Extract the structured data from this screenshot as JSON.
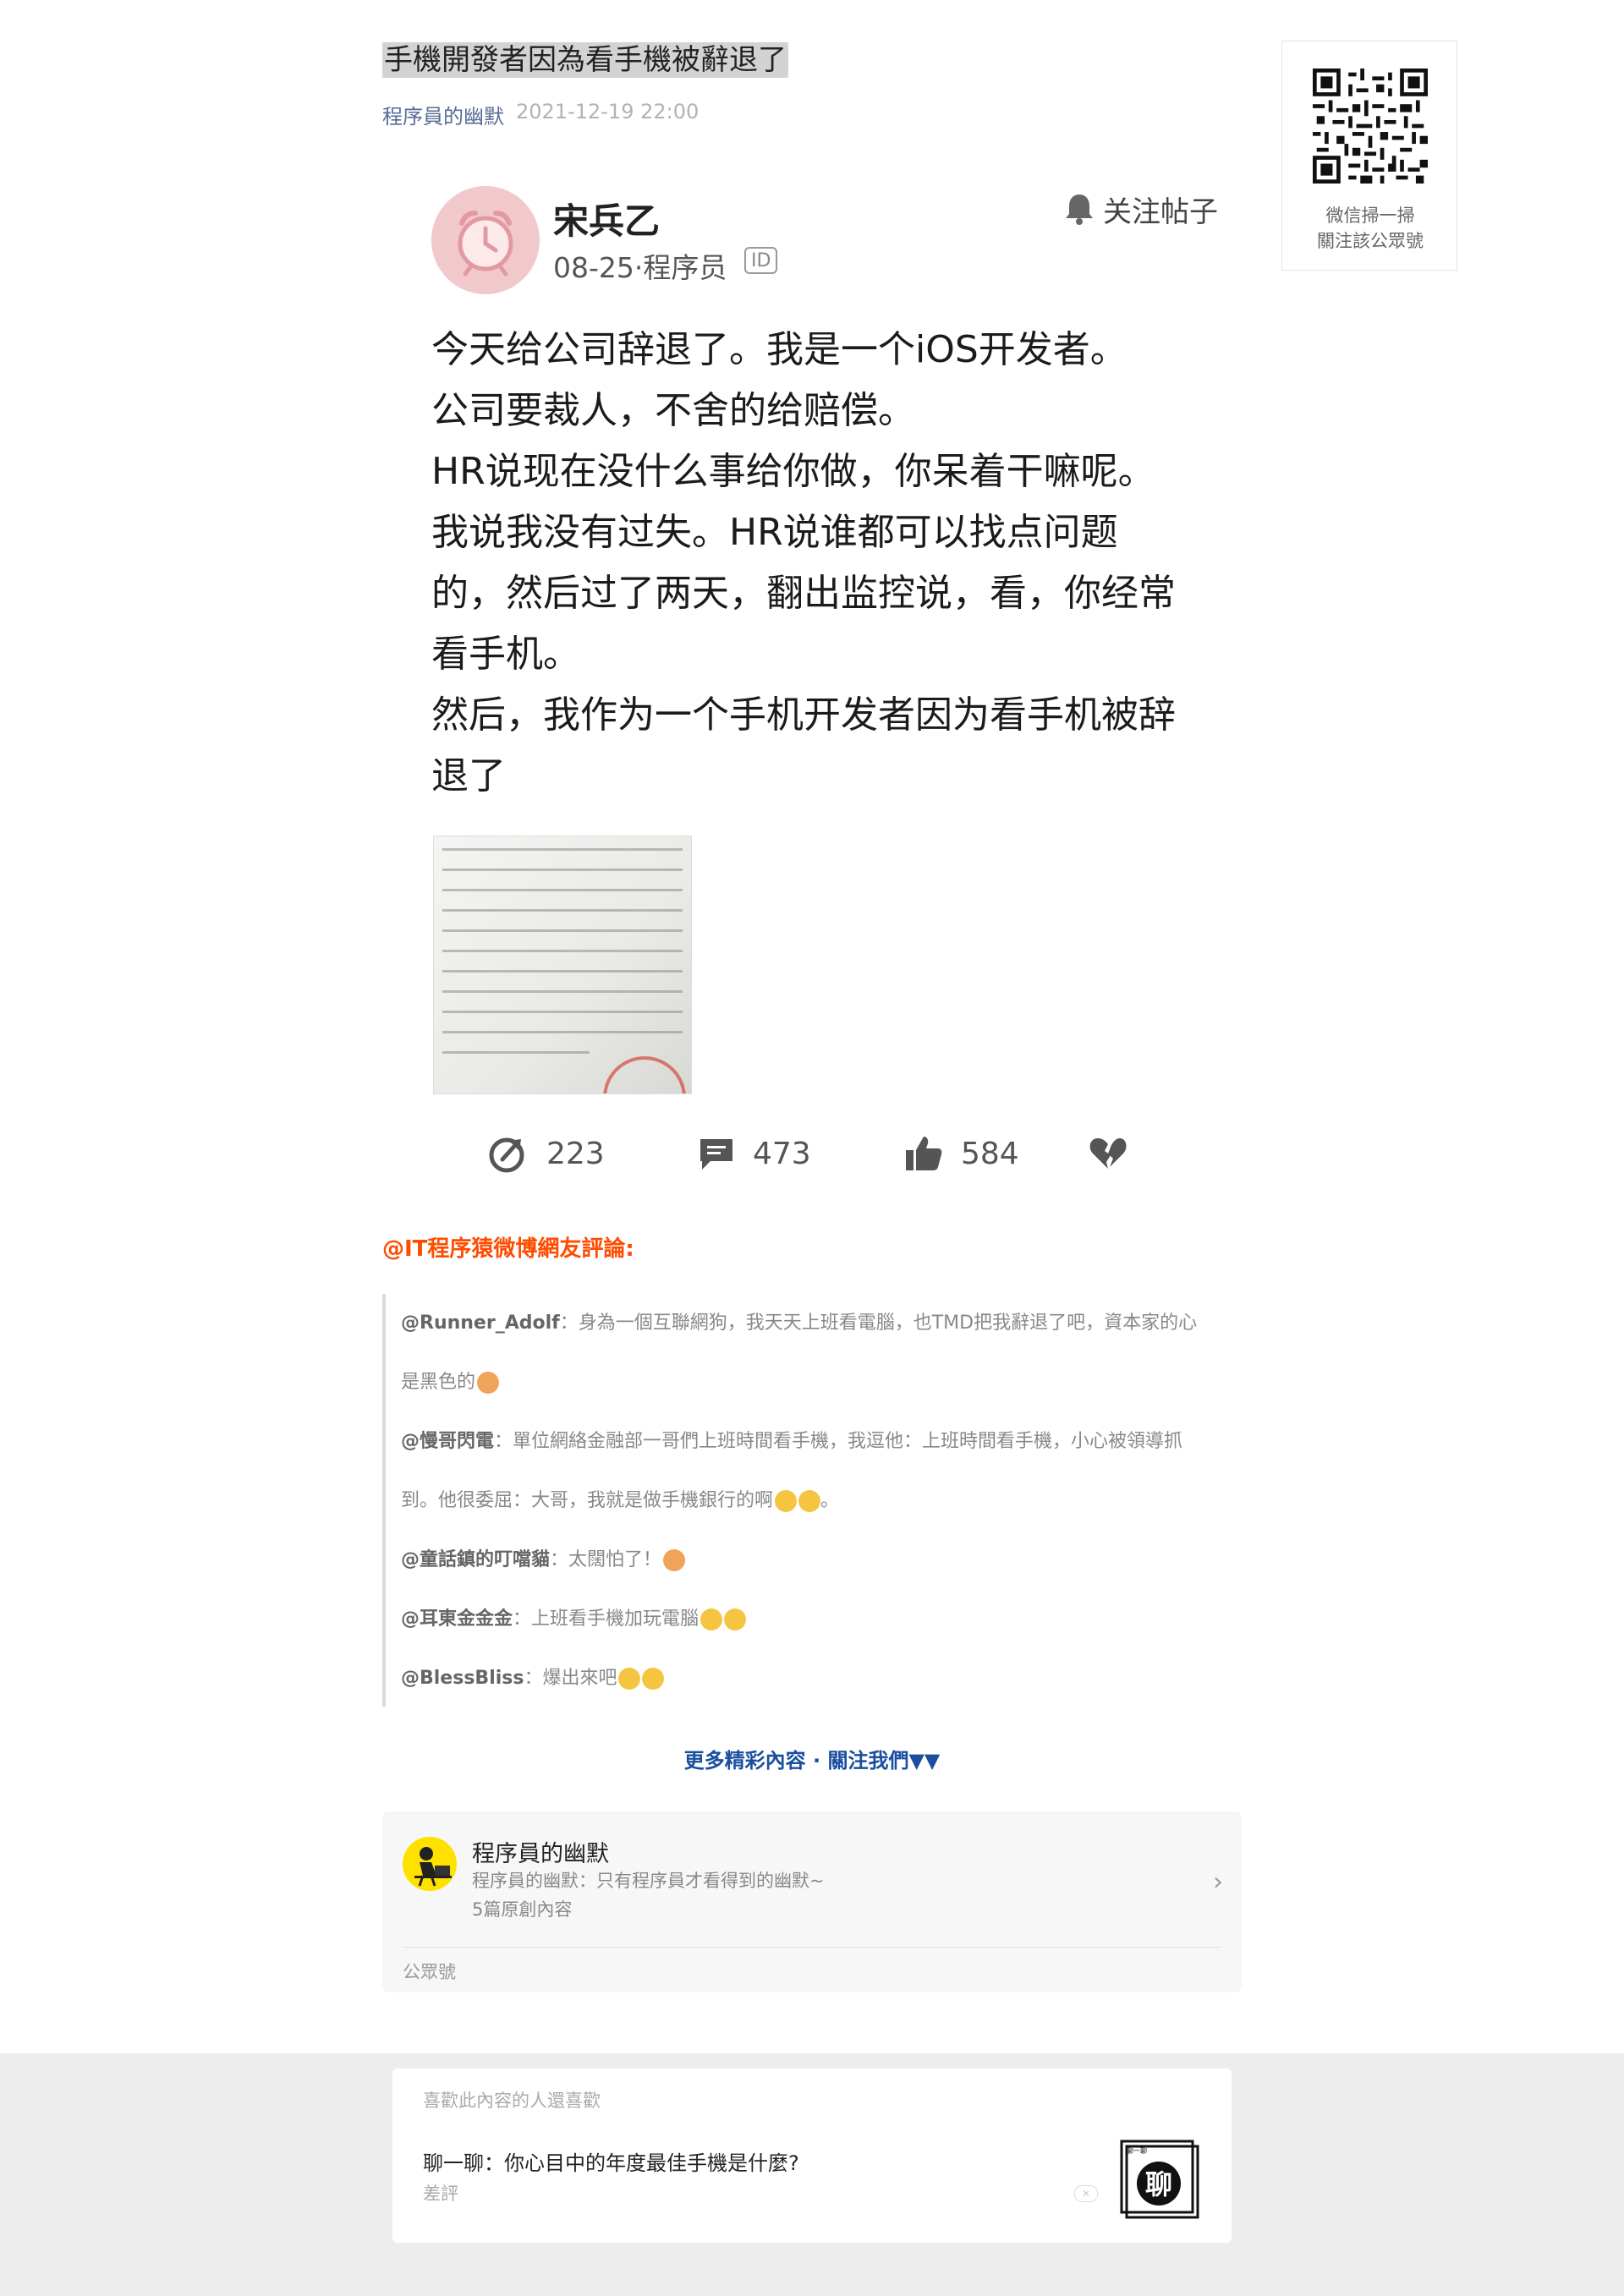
{
  "article": {
    "title": "手機開發者因為看手機被辭退了",
    "author": "程序員的幽默",
    "date": "2021-12-19 22:00"
  },
  "qr": {
    "caption_line1": "微信掃一掃",
    "caption_line2": "關注該公眾號"
  },
  "post": {
    "author": "宋兵乙",
    "meta": "08-25·程序员",
    "id_badge": "ID",
    "follow_label": "关注帖子",
    "lines": [
      "今天给公司辞退了。我是一个iOS开发者。",
      "公司要裁人，不舍的给赔偿。",
      "HR说现在没什么事给你做，你呆着干嘛呢。",
      "我说我没有过失。HR说谁都可以找点问题",
      "的，然后过了两天，翻出监控说，看，你经常",
      "看手机。",
      "然后，我作为一个手机开发者因为看手机被辞",
      "退了"
    ],
    "actions": {
      "share_count": "223",
      "comment_count": "473",
      "like_count": "584"
    }
  },
  "comments": {
    "heading": "@IT程序猿微博網友評論:",
    "items": [
      {
        "handle": "@Runner_Adolf",
        "line1": "：身為一個互聯網狗，我天天上班看電腦，也TMD把我辭退了吧，資本家的心",
        "line2": "是黑色的"
      },
      {
        "handle": "@慢哥閃電",
        "line1": "：單位網絡金融部一哥們上班時間看手機，我逗他：上班時間看手機，小心被領導抓",
        "line2": "到。他很委屈：大哥，我就是做手機銀行的啊",
        "line2_tail": "。"
      },
      {
        "handle": "@童話鎮的叮噹貓",
        "text": "：太闊怕了！"
      },
      {
        "handle": "@耳東金金金",
        "text": "：上班看手機加玩電腦"
      },
      {
        "handle": "@BlessBliss",
        "text": "：爆出來吧"
      }
    ]
  },
  "more_link": "更多精彩內容 · 關注我們▼▼",
  "profile": {
    "name": "程序員的幽默",
    "description": "程序員的幽默：只有程序員才看得到的幽默~",
    "count": "5篇原創內容",
    "type": "公眾號"
  },
  "recommend": {
    "heading": "喜歡此內容的人還喜歡",
    "title": "聊一聊：你心目中的年度最佳手機是什麼?",
    "tag": "差評",
    "close_glyph": "✕",
    "thumb_glyph": "聊",
    "thumb_mini": "聊一聊"
  },
  "colors": {
    "accent_link": "#576b95",
    "comment_heading": "#ff4c00",
    "more_link": "#1a4fa0"
  }
}
